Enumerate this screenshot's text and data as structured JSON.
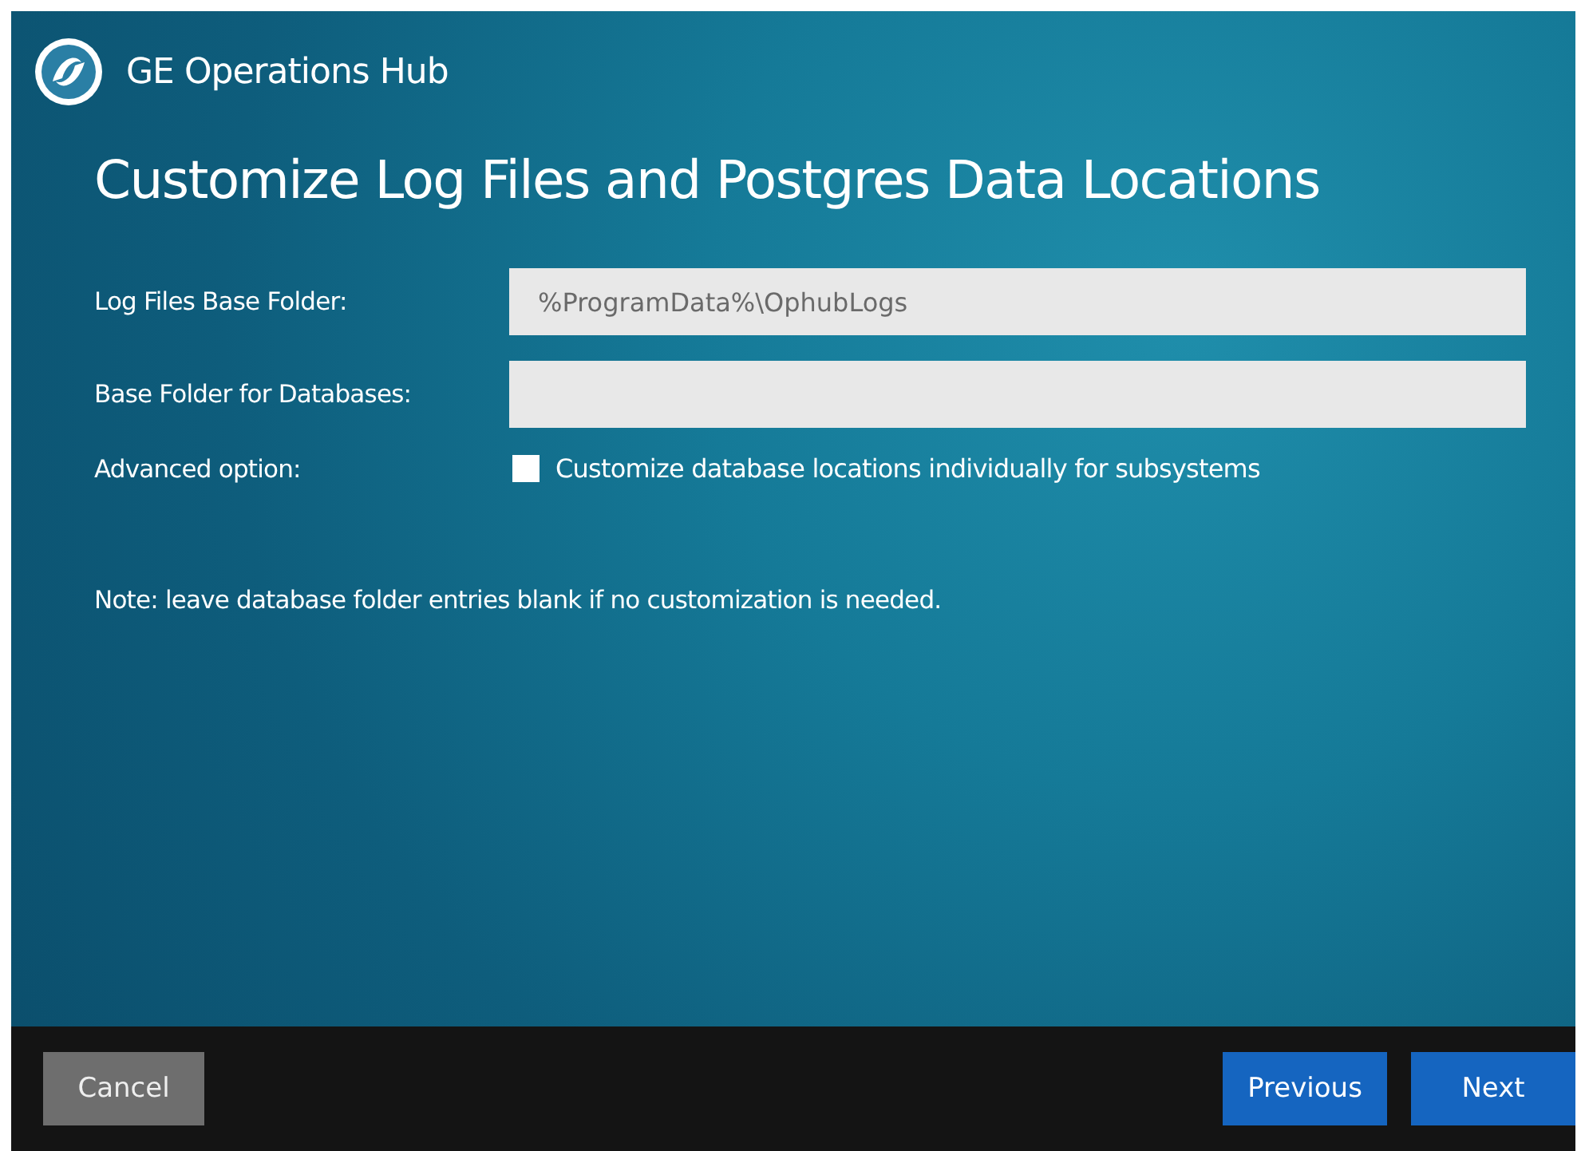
{
  "header": {
    "product": "GE Operations Hub"
  },
  "title": "Customize Log Files and Postgres Data Locations",
  "fields": [
    {
      "label": "Log Files Base Folder:",
      "value": "%ProgramData%\\OphubLogs"
    },
    {
      "label": "Base Folder for Databases:"
    }
  ],
  "advanced": {
    "label": "Advanced option:",
    "checkbox": {
      "label": "Customize database locations individually for subsystems",
      "checked": false
    }
  },
  "note": "Note: leave database folder entries blank if no customization is needed.",
  "buttons": [
    {
      "label": "Cancel",
      "kind": "secondary"
    },
    {
      "label": "Previous",
      "kind": "primary"
    },
    {
      "label": "Next",
      "kind": "primary"
    }
  ]
}
